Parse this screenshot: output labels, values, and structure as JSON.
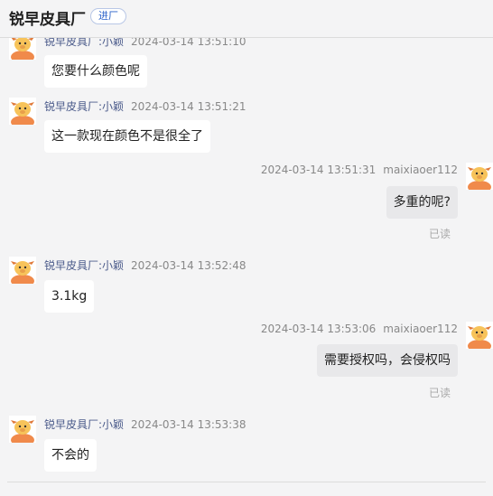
{
  "header": {
    "shop_name": "锐早皮具厂",
    "enter_badge": "进厂"
  },
  "messages": [
    {
      "side": "left",
      "sender": "锐早皮具厂:小颖",
      "time": "2024-03-14 13:51:10",
      "text": "您要什么颜色呢"
    },
    {
      "side": "left",
      "sender": "锐早皮具厂:小颖",
      "time": "2024-03-14 13:51:21",
      "text": "这一款现在颜色不是很全了"
    },
    {
      "side": "right",
      "user": "maixiaoer112",
      "time": "2024-03-14 13:51:31",
      "text": "多重的呢?",
      "status": "已读"
    },
    {
      "side": "left",
      "sender": "锐早皮具厂:小颖",
      "time": "2024-03-14 13:52:48",
      "text": "3.1kg"
    },
    {
      "side": "right",
      "user": "maixiaoer112",
      "time": "2024-03-14 13:53:06",
      "text": "需要授权吗，会侵权吗",
      "status": "已读"
    },
    {
      "side": "left",
      "sender": "锐早皮具厂:小颖",
      "time": "2024-03-14 13:53:38",
      "text": "不会的"
    }
  ]
}
